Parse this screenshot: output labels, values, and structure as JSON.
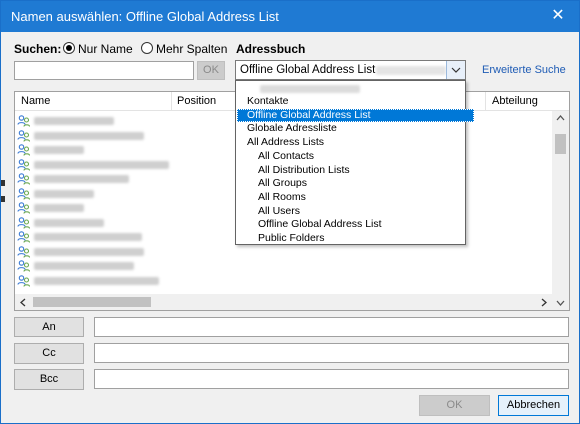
{
  "window": {
    "title": "Namen auswählen: Offline Global Address List",
    "close_glyph": "✕"
  },
  "search": {
    "label": "Suchen:",
    "radio_name": "Nur Name",
    "radio_more": "Mehr Spalten",
    "selected": "Nur Name",
    "input_value": "",
    "ok_label": "OK"
  },
  "addressbook": {
    "label": "Adressbuch",
    "value": "Offline Global Address List -",
    "advanced_link": "Erweiterte Suche",
    "options": [
      {
        "label": "Kontakte",
        "indent": 0
      },
      {
        "label": "Offline Global Address List",
        "indent": 0,
        "selected": true
      },
      {
        "label": "Globale Adressliste",
        "indent": 0
      },
      {
        "label": "All Address Lists",
        "indent": 0
      },
      {
        "label": "All Contacts",
        "indent": 1
      },
      {
        "label": "All Distribution Lists",
        "indent": 1
      },
      {
        "label": "All Groups",
        "indent": 1
      },
      {
        "label": "All Rooms",
        "indent": 1
      },
      {
        "label": "All Users",
        "indent": 1
      },
      {
        "label": "Offline Global Address List",
        "indent": 1
      },
      {
        "label": "Public Folders",
        "indent": 1
      }
    ]
  },
  "list": {
    "columns": [
      "Name",
      "Position",
      "Abteilung"
    ],
    "rows": 12
  },
  "recipients": {
    "to_label": "An",
    "cc_label": "Cc",
    "bcc_label": "Bcc"
  },
  "footer": {
    "ok_label": "OK",
    "cancel_label": "Abbrechen"
  },
  "colors": {
    "titlebar": "#1f7ad3",
    "selection": "#0078d7",
    "link": "#1f5cb5"
  }
}
